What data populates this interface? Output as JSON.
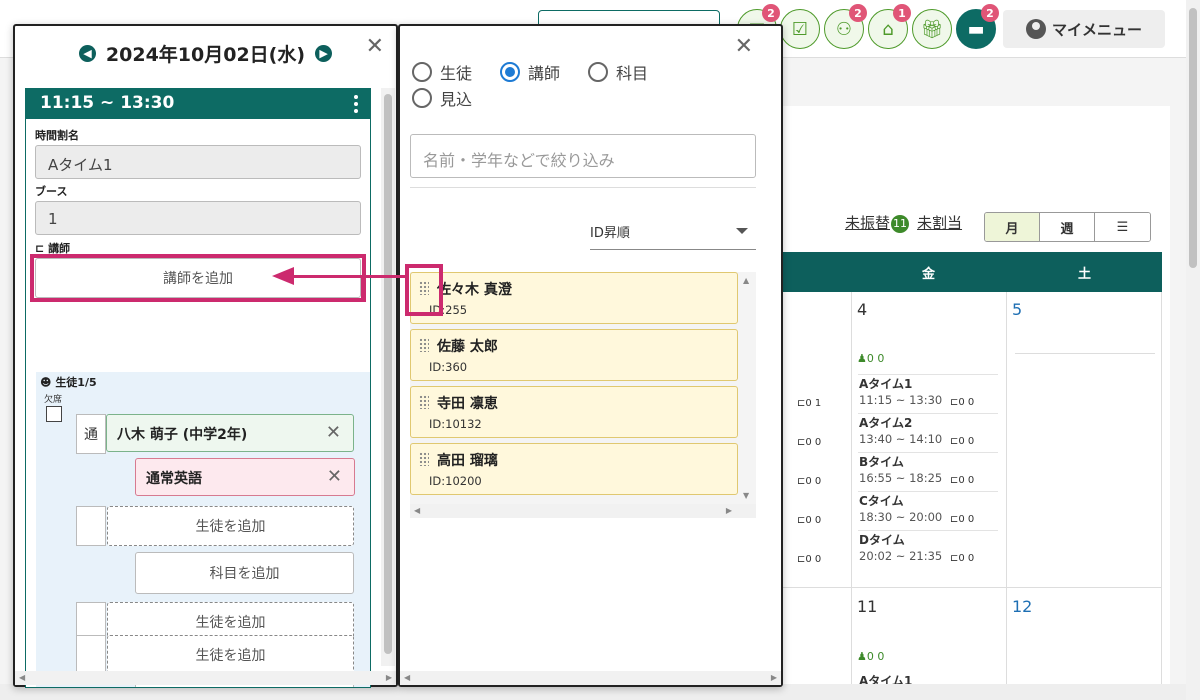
{
  "topbar": {
    "badges": [
      "2",
      "2",
      "1",
      "2"
    ],
    "my_menu_label": "マイメニュー"
  },
  "calendar": {
    "unassigned_transfer_label": "未振替",
    "unassigned_transfer_count": "11",
    "unallocated_label": "未割当",
    "view_month": "月",
    "view_week": "週",
    "view_list_icon": "list-icon",
    "day_fri": "金",
    "day_sat": "土",
    "dates": {
      "d4": "4",
      "d5": "5",
      "d11": "11",
      "d12": "12"
    },
    "fri_slots": [
      {
        "name": "Aタイム1",
        "time": "11:15 ~ 13:30",
        "counts": "0 0"
      },
      {
        "name": "Aタイム2",
        "time": "13:40 ~ 14:10",
        "counts": "0 0"
      },
      {
        "name": "Bタイム",
        "time": "16:55 ~ 18:25",
        "counts": "0 0"
      },
      {
        "name": "Cタイム",
        "time": "18:30 ~ 20:00",
        "counts": "0 0"
      },
      {
        "name": "Dタイム",
        "time": "20:02 ~ 21:35",
        "counts": "0 0"
      }
    ],
    "fri_header_counts": "0  0",
    "thu_counts": [
      "0 1",
      "0 0",
      "0 0",
      "0 0",
      "0 0"
    ],
    "week2_fri_counts": "0  0",
    "week2_fri_slot": "Aタイム1"
  },
  "lesson_panel": {
    "date": "2024年10月02日(水)",
    "time_range": "11:15 ~ 13:30",
    "timetable_label": "時間割名",
    "timetable_value": "Aタイム1",
    "booth_label": "ブース",
    "booth_value": "1",
    "teacher_label": "講師",
    "add_teacher": "講師を追加",
    "students_label": "生徒1/5",
    "absent_label": "欠席",
    "attend_type": "通",
    "student_name": "八木 萌子 (中学2年)",
    "subject_name": "通常英語",
    "add_student": "生徒を追加",
    "add_subject": "科目を追加"
  },
  "teacher_panel": {
    "radio_student": "生徒",
    "radio_teacher": "講師",
    "radio_subject": "科目",
    "radio_prospect": "見込",
    "filter_placeholder": "名前・学年などで絞り込み",
    "sort_label": "ID昇順",
    "teachers": [
      {
        "name": "佐々木 真澄",
        "id": "ID:255"
      },
      {
        "name": "佐藤 太郎",
        "id": "ID:360"
      },
      {
        "name": "寺田 凛恵",
        "id": "ID:10132"
      },
      {
        "name": "高田 瑠璃",
        "id": "ID:10200"
      }
    ]
  }
}
